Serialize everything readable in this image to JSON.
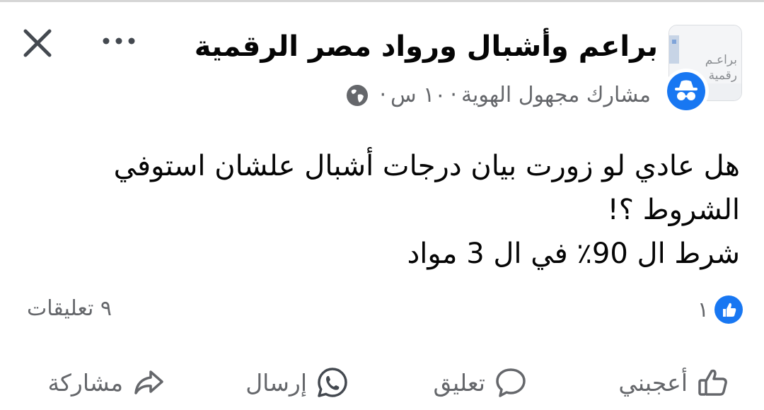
{
  "header": {
    "group_name": "براعم وأشبال ورواد مصر الرقمية",
    "avatar_text_line1": "براعـم",
    "avatar_text_line2": "رقمية",
    "author": "مشارك مجهول الهوية",
    "time": "١٠ س",
    "separator": "·"
  },
  "post": {
    "line1": "هل عادي لو زورت بيان درجات أشبال علشان استوفي",
    "line2": "الشروط ؟!",
    "line3": "شرط ال 90٪ في ال 3 مواد"
  },
  "stats": {
    "likes": "١",
    "comments": "٩ تعليقات"
  },
  "actions": {
    "like": "أعجبني",
    "comment": "تعليق",
    "send": "إرسال",
    "share": "مشاركة"
  },
  "colors": {
    "accent": "#1877f2",
    "secondary_text": "#65676b",
    "primary_text": "#050505"
  },
  "icons": [
    "close-icon",
    "more-icon",
    "anonymous-icon",
    "globe-icon",
    "like-reaction-icon",
    "thumbs-up-icon",
    "comment-icon",
    "whatsapp-icon",
    "share-icon"
  ]
}
